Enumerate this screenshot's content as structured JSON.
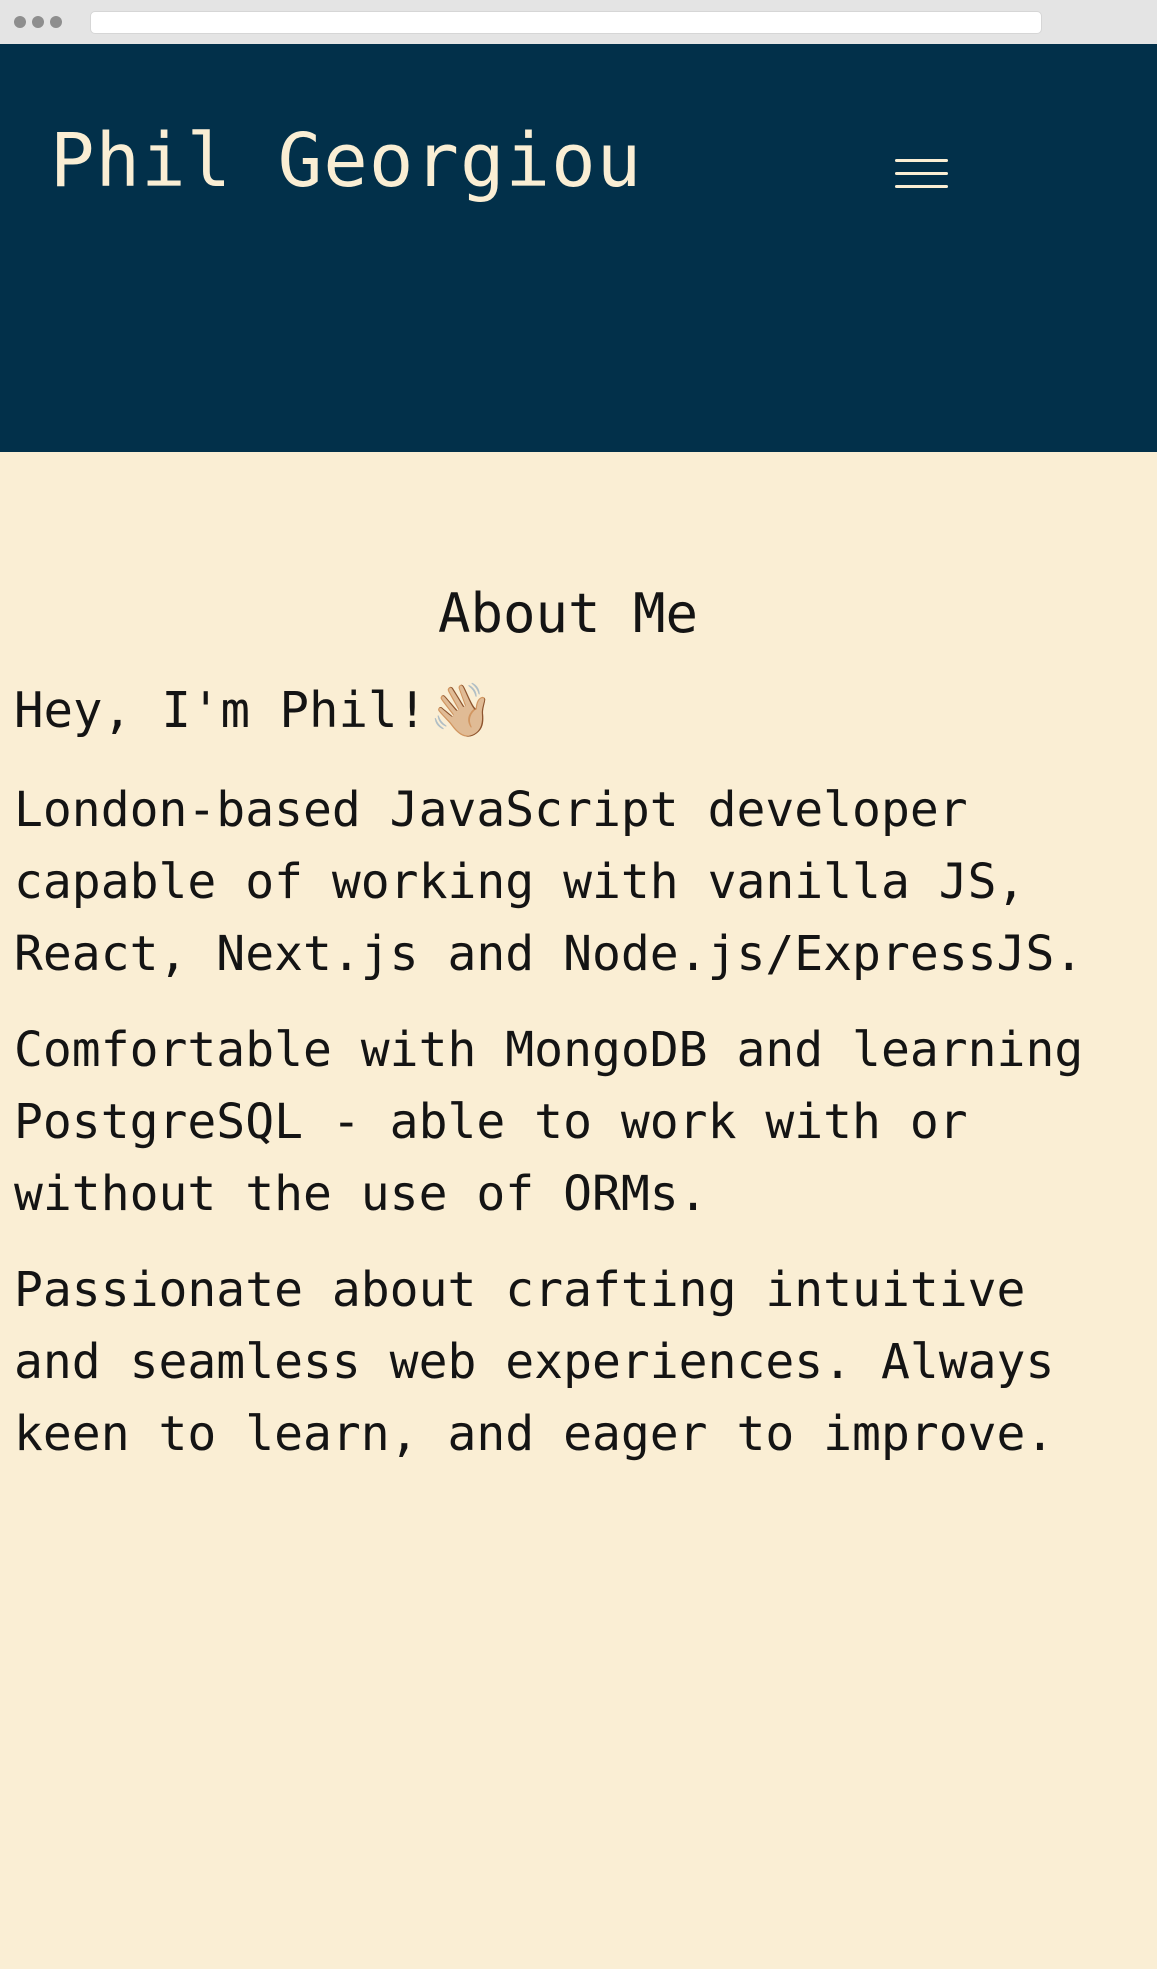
{
  "header": {
    "site_title": "Phil Georgiou",
    "menu_icon": "hamburger-menu-icon"
  },
  "about": {
    "heading": "About Me",
    "greeting": "Hey, I'm Phil!",
    "greeting_emoji": "👋🏼",
    "paragraphs": [
      {
        "lines": [
          "London-based JavaScript developer",
          "capable of working with vanilla JS,",
          "React, Next.js and Node.js/ExpressJS."
        ]
      },
      {
        "lines": [
          "Comfortable with MongoDB and learning",
          "PostgreSQL - able to work with or",
          "without the use of ORMs."
        ]
      },
      {
        "lines": [
          "Passionate about crafting intuitive",
          "and seamless web experiences. Always",
          "keen to learn, and eager to improve."
        ]
      }
    ]
  },
  "colors": {
    "header_bg": "#02304A",
    "page_bg": "#FAEED4",
    "text": "#141414"
  }
}
